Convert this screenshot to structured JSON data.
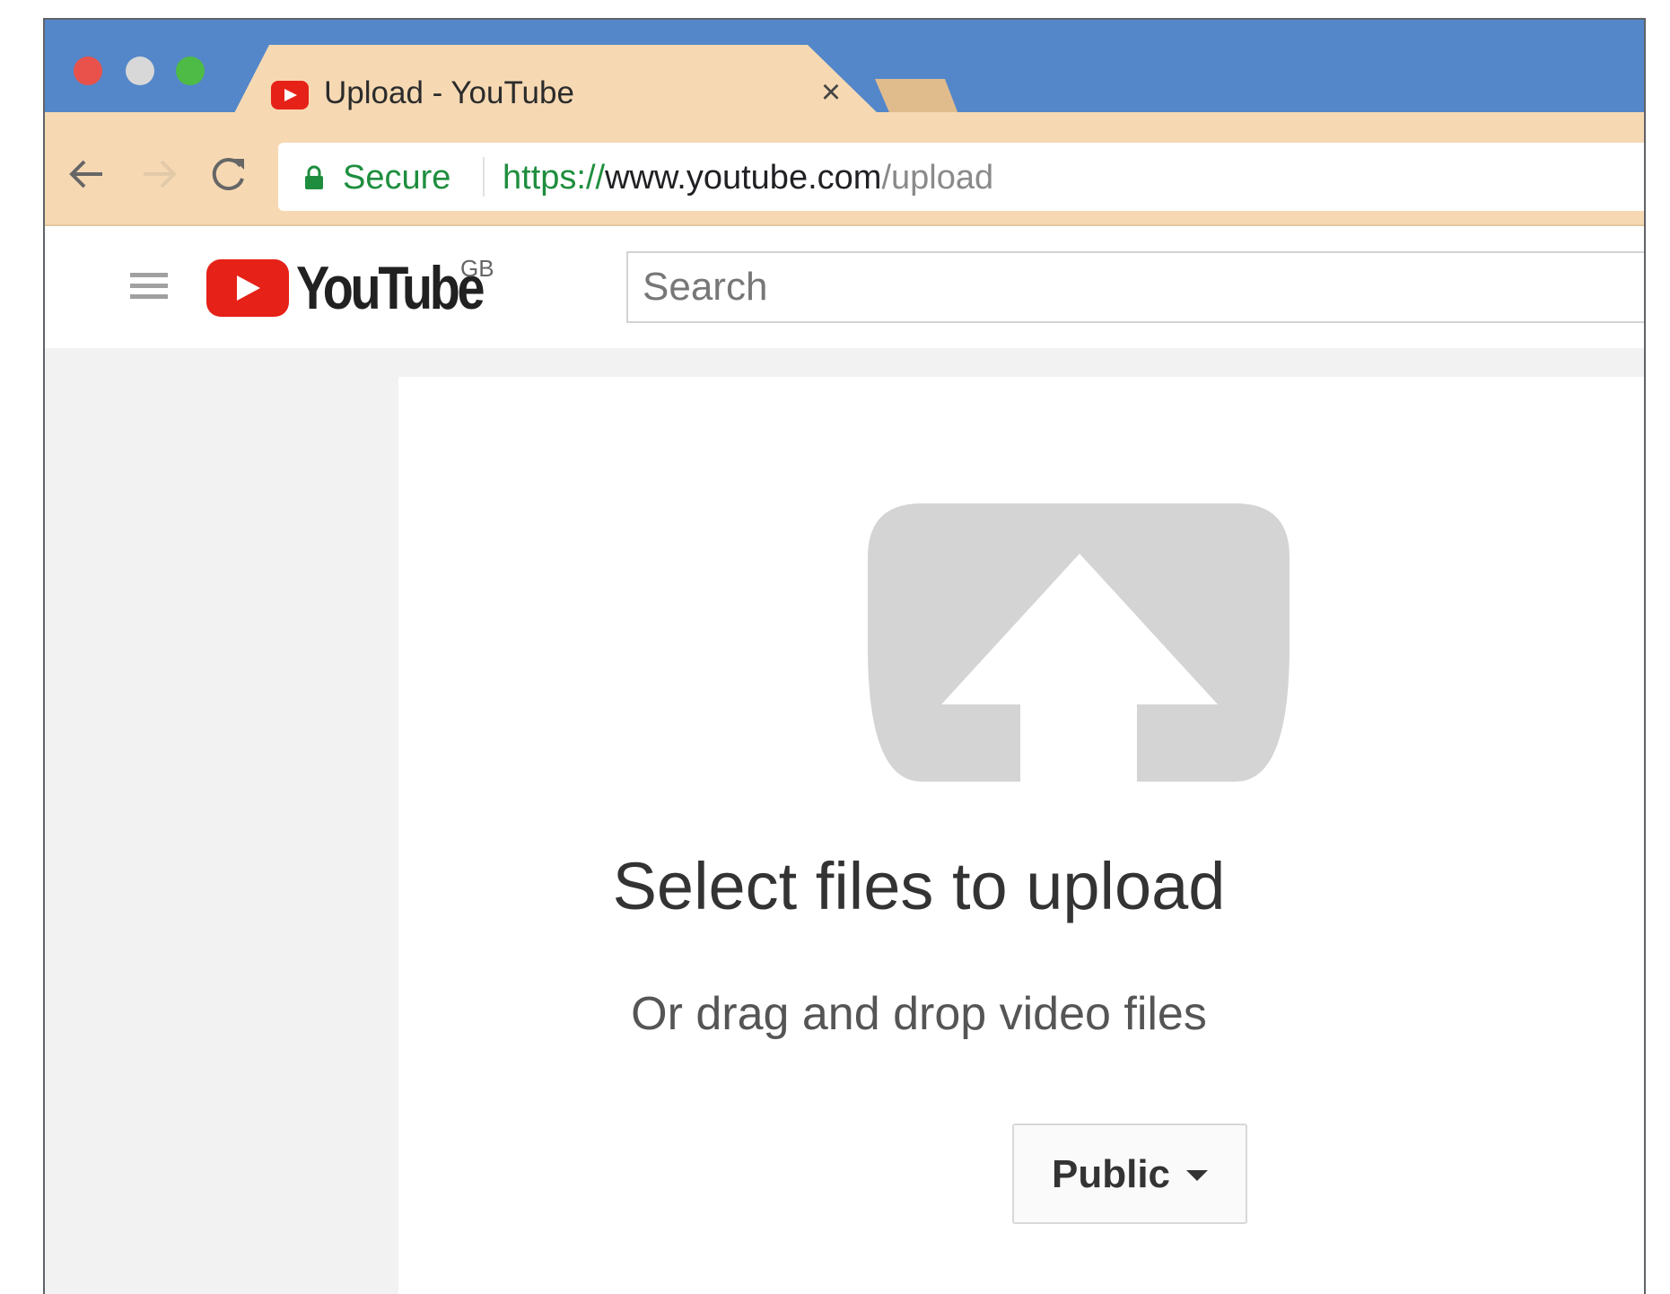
{
  "browser": {
    "tab": {
      "title": "Upload - YouTube",
      "close_glyph": "×",
      "favicon": "youtube-favicon-icon"
    },
    "address_bar": {
      "security_label": "Secure",
      "url_scheme": "https://",
      "url_host": "www.youtube.com",
      "url_path": "/upload"
    },
    "colors": {
      "tab_strip": "#5487c9",
      "active_tab": "#f6d9b3",
      "secure_green": "#1e8e3e"
    }
  },
  "masthead": {
    "logo_text": "YouTube",
    "region": "GB",
    "search": {
      "placeholder": "Search",
      "value": ""
    },
    "brand_red": "#e62117"
  },
  "upload": {
    "icon": "upload-arrow-icon",
    "title": "Select files to upload",
    "subtitle": "Or drag and drop video files",
    "privacy": {
      "selected": "Public"
    }
  }
}
